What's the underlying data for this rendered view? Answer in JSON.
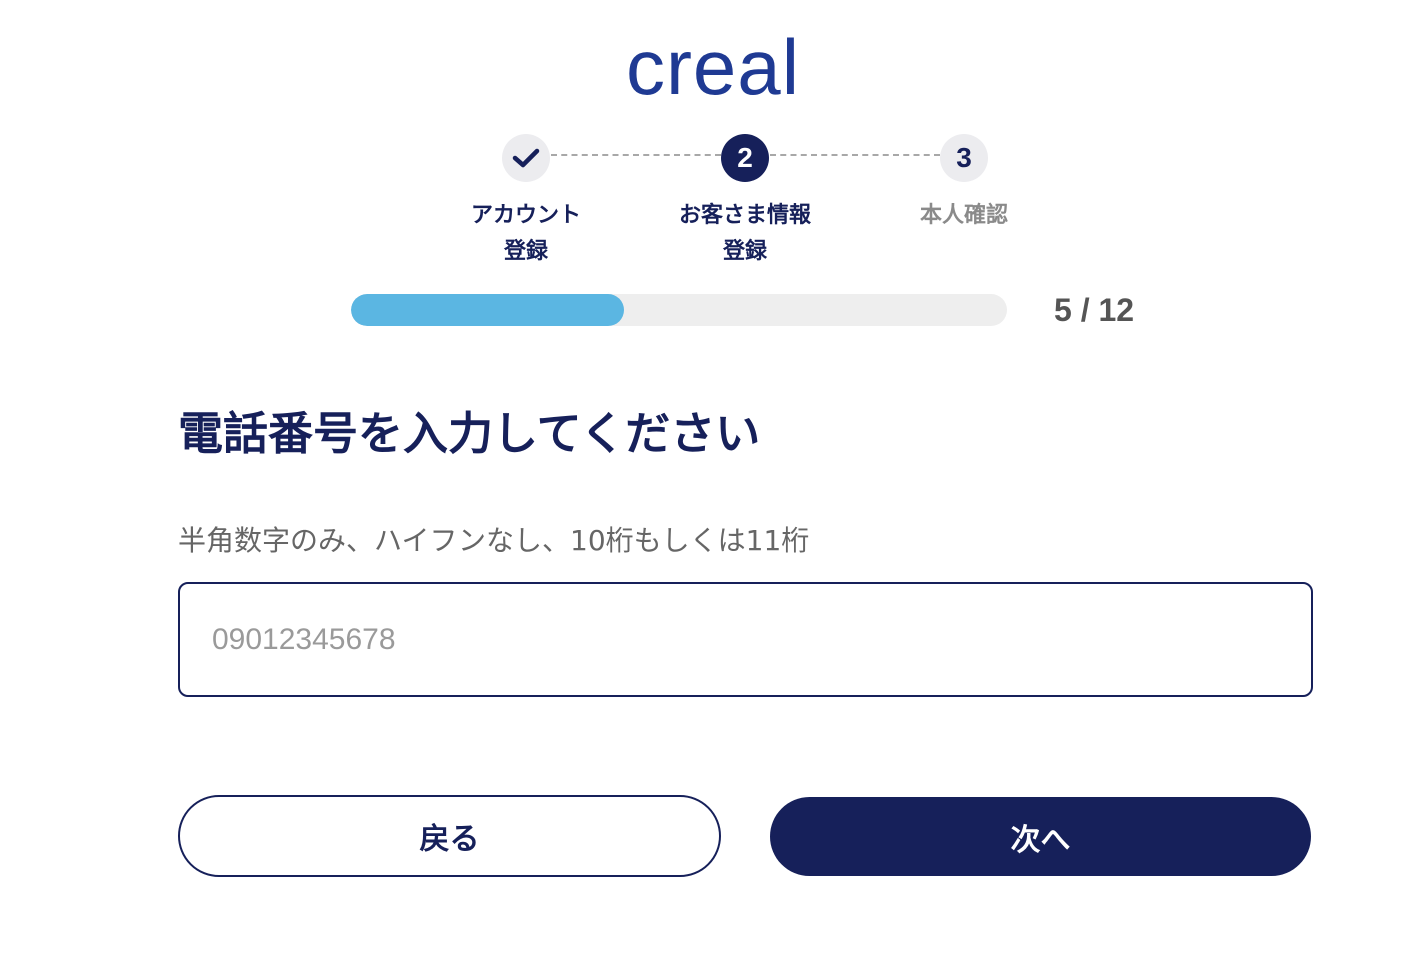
{
  "brand": {
    "logo_text": "creal",
    "primary_color": "#16205a",
    "logo_color": "#1f3a93",
    "accent_color": "#5bb6e2"
  },
  "stepper": {
    "steps": [
      {
        "number": "1",
        "icon": "check-icon",
        "state": "done",
        "label_line1": "アカウント",
        "label_line2": "登録"
      },
      {
        "number": "2",
        "state": "current",
        "label_line1": "お客さま情報",
        "label_line2": "登録"
      },
      {
        "number": "3",
        "state": "todo",
        "label_line1": "本人確認",
        "label_line2": ""
      }
    ]
  },
  "progress": {
    "current": 5,
    "total": 12,
    "text": "5 / 12",
    "fraction": 0.4167
  },
  "form": {
    "heading": "電話番号を入力してください",
    "hint": "半角数字のみ、ハイフンなし、10桁もしくは11桁",
    "phone": {
      "value": "",
      "placeholder": "09012345678"
    }
  },
  "actions": {
    "back_label": "戻る",
    "next_label": "次へ"
  }
}
